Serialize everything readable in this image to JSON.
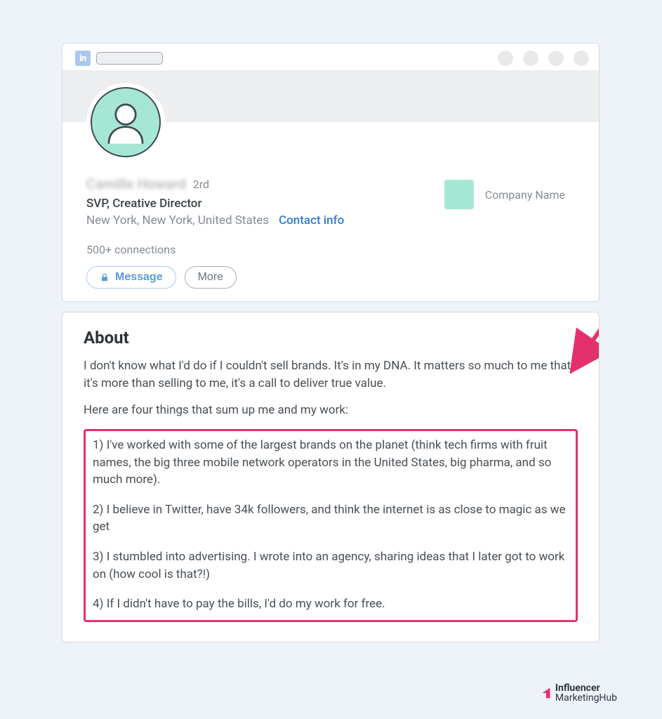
{
  "profile": {
    "name_blurred": "Camille Howard",
    "degree": "2rd",
    "headline": "SVP, Creative Director",
    "location": "New York, New York, United States",
    "contact_link": "Contact info",
    "connections": "500+ connections",
    "message_label": "Message",
    "more_label": "More"
  },
  "company": {
    "name": "Company Name"
  },
  "about": {
    "title": "About",
    "intro1": "I don't know what I'd do if I couldn't sell brands. It's in my DNA. It matters so much to me that it's more than selling to me, it's a call to deliver true value.",
    "intro2": "Here are four things that sum up me and my work:",
    "point1": "1) I've worked with some of the largest brands on the planet (think tech firms with fruit names, the big three mobile network operators in the United States, big pharma, and so much more).",
    "point2": "2) I believe in Twitter, have 34k followers, and think the internet is as close to magic as we get",
    "point3": "3) I stumbled into advertising. I wrote into an agency, sharing ideas that I later got to work on (how cool is that?!)",
    "point4": "4) If I didn't have to pay the bills, I'd do my work for free."
  },
  "footer": {
    "line1": "Influencer",
    "line2": "MarketingHub"
  },
  "colors": {
    "accent_teal": "#a6e6d5",
    "highlight_pink": "#e5306e",
    "link_blue": "#2f7dd1"
  }
}
